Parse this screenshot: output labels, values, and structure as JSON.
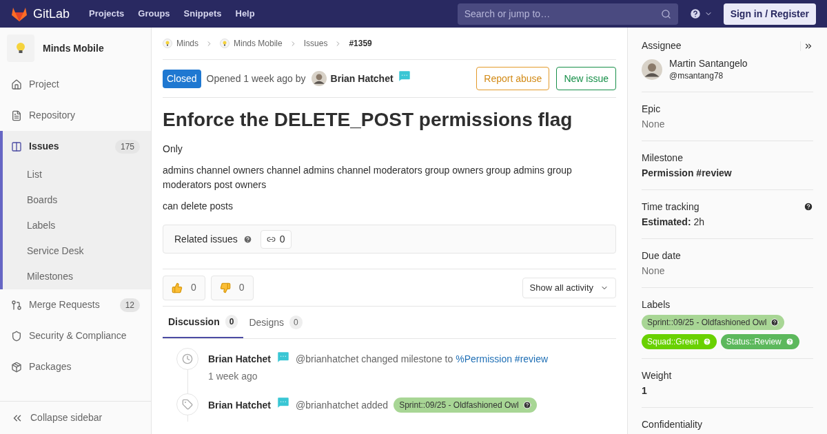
{
  "navbar": {
    "brand": "GitLab",
    "links": [
      "Projects",
      "Groups",
      "Snippets",
      "Help"
    ],
    "search": {
      "placeholder": "Search or jump to…"
    },
    "sign_in": "Sign in / Register"
  },
  "sidebar": {
    "project": "Minds Mobile",
    "items": [
      {
        "label": "Project",
        "selected": false
      },
      {
        "label": "Repository",
        "selected": false
      },
      {
        "label": "Issues",
        "selected": true,
        "count": "175",
        "children": [
          {
            "label": "List",
            "selected": false
          },
          {
            "label": "Boards",
            "selected": false
          },
          {
            "label": "Labels",
            "selected": false
          },
          {
            "label": "Service Desk",
            "selected": false
          },
          {
            "label": "Milestones",
            "selected": false
          }
        ]
      },
      {
        "label": "Merge Requests",
        "selected": false,
        "count": "12"
      },
      {
        "label": "Security & Compliance",
        "selected": false
      },
      {
        "label": "Packages",
        "selected": false
      }
    ],
    "collapse": "Collapse sidebar"
  },
  "breadcrumbs": [
    "Minds",
    "Minds Mobile",
    "Issues",
    "#1359"
  ],
  "issue": {
    "status": "Closed",
    "opened": "Opened 1 week ago by",
    "author": "Brian Hatchet",
    "buttons": [
      "Report abuse",
      "New issue"
    ],
    "title": "Enforce the DELETE_POST permissions flag",
    "description": [
      "Only",
      "admins channel owners channel admins channel moderators group owners group admins group moderators post owners",
      "can delete posts"
    ],
    "related": {
      "label": "Related issues",
      "count": "0"
    },
    "awards": [
      {
        "kind": "up",
        "count": "0"
      },
      {
        "kind": "down",
        "count": "0"
      }
    ],
    "filter": "Show all activity",
    "tabs": [
      {
        "label": "Discussion",
        "count": "0",
        "selected": true
      },
      {
        "label": "Designs",
        "count": "0",
        "selected": false
      }
    ],
    "activity": [
      {
        "kind": "milestone",
        "author": "Brian Hatchet",
        "text": "@brianhatchet changed milestone to",
        "link": "%Permission #review",
        "time": "1 week ago"
      },
      {
        "kind": "label",
        "author": "Brian Hatchet",
        "text": "@brianhatchet added",
        "label": {
          "text": "Sprint::09/25 - Oldfashioned Owl",
          "color": "#a8d695",
          "dark": true
        }
      }
    ]
  },
  "details": {
    "assignee": {
      "heading": "Assignee",
      "name": "Martin Santangelo",
      "handle": "@msantang78"
    },
    "epic": {
      "heading": "Epic",
      "value": "None"
    },
    "milestone": {
      "heading": "Milestone",
      "value": "Permission #review"
    },
    "time_tracking": {
      "heading": "Time tracking",
      "label": "Estimated:",
      "value": "2h"
    },
    "due_date": {
      "heading": "Due date",
      "value": "None"
    },
    "labels": {
      "heading": "Labels",
      "items": [
        {
          "text": "Sprint::09/25 - Oldfashioned Owl",
          "color": "#a8d695",
          "dark": true
        },
        {
          "text": "Squad::Green",
          "color": "#69d100",
          "dark": false
        },
        {
          "text": "Status::Review",
          "color": "#5cb85c",
          "dark": false
        }
      ]
    },
    "weight": {
      "heading": "Weight",
      "value": "1"
    },
    "confidentiality": {
      "heading": "Confidentiality"
    }
  }
}
